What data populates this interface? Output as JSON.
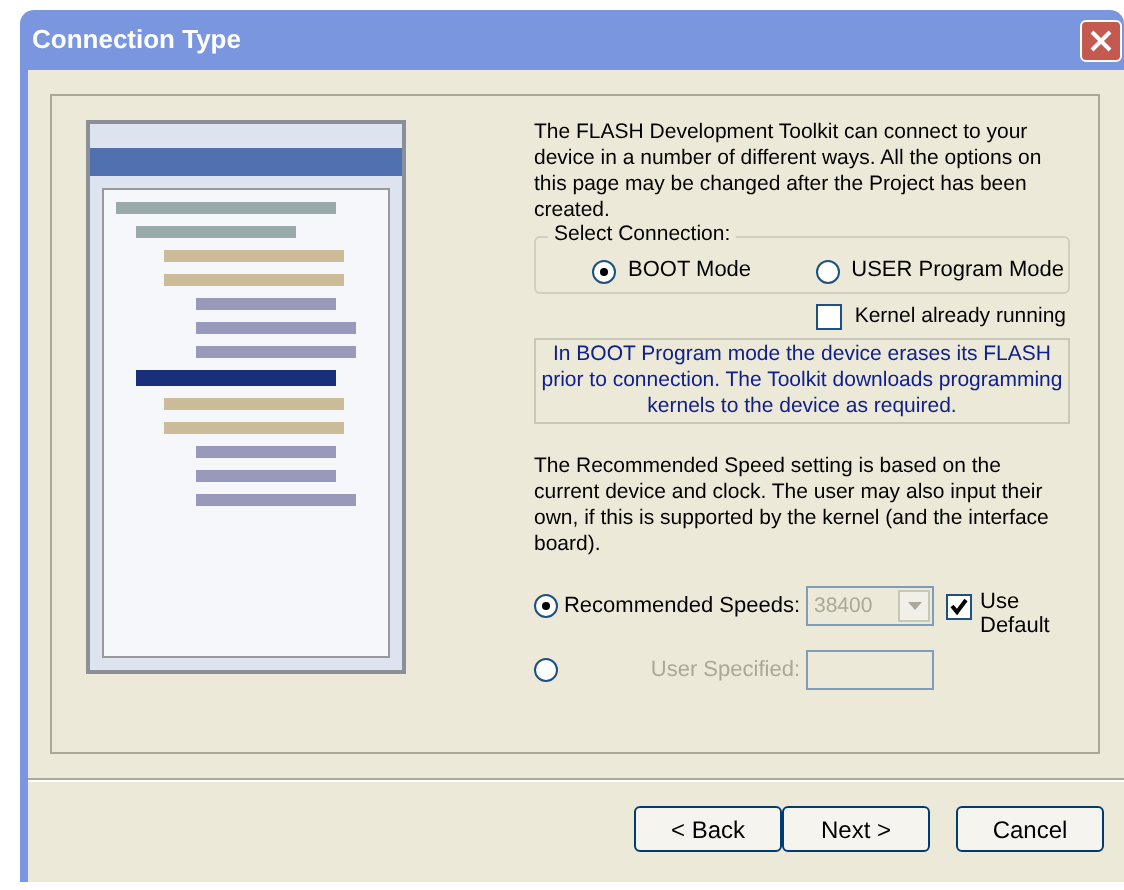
{
  "window": {
    "title": "Connection Type"
  },
  "intro": "The FLASH Development Toolkit can connect to your device in a number of different ways. All the options on this page may be changed after the Project has been created.",
  "connection": {
    "legend": "Select Connection:",
    "options": [
      {
        "label": "BOOT Mode",
        "selected": true
      },
      {
        "label": "USER Program Mode",
        "selected": false
      }
    ]
  },
  "kernel_running": {
    "label": "Kernel already running",
    "checked": false
  },
  "info": "In BOOT Program mode the device erases its FLASH prior to connection. The Toolkit downloads programming kernels to the device as required.",
  "speed_text": "The Recommended Speed setting is based on the current device and clock. The user may also input their own, if this is supported by the kernel (and the interface board).",
  "speed_options": [
    {
      "kind": "dropdown",
      "label": "Recommended Speeds:",
      "value": "38400",
      "selected": true,
      "disabled": true
    },
    {
      "kind": "input",
      "label": "User Specified:",
      "selected": false,
      "disabled": true
    }
  ],
  "use_default": {
    "label": "Use Default",
    "checked": true
  },
  "buttons": [
    "< Back",
    "Next >",
    "Cancel"
  ]
}
